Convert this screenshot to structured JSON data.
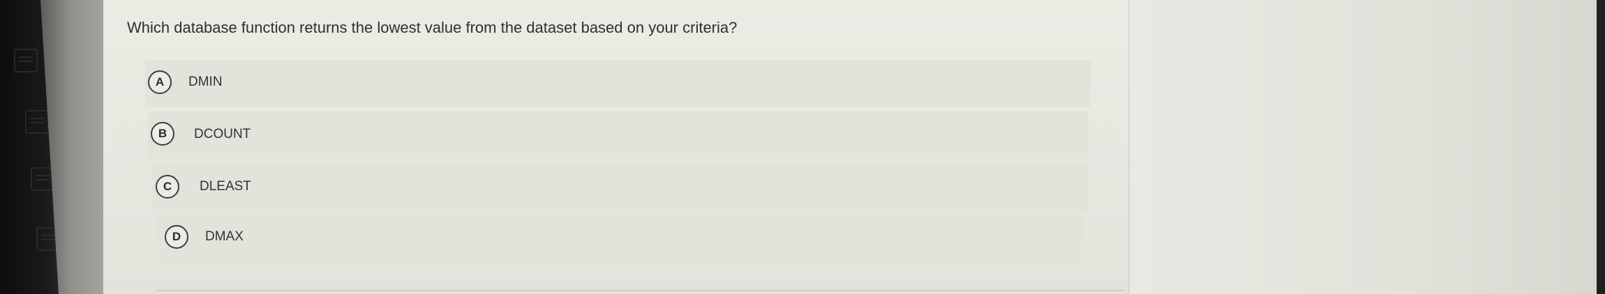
{
  "question": {
    "text": "Which database function returns the lowest value from the dataset based on your criteria?"
  },
  "options": [
    {
      "letter": "A",
      "text": "DMIN"
    },
    {
      "letter": "B",
      "text": "DCOUNT"
    },
    {
      "letter": "C",
      "text": "DLEAST"
    },
    {
      "letter": "D",
      "text": "DMAX"
    }
  ],
  "desktop_icons": [
    "sheet-icon",
    "sheet-icon",
    "sheet-icon",
    "sheet-icon",
    "sheet-icon"
  ]
}
